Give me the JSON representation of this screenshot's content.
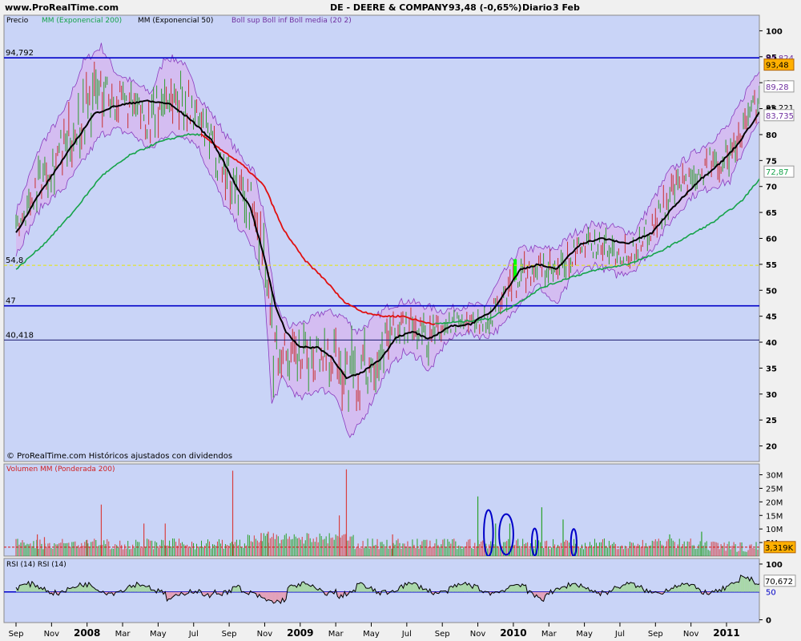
{
  "site": "www.ProRealTime.com",
  "header": {
    "symbol": "DE - DEERE & COMPANY",
    "quote": "93,48 (-0,65%)",
    "period": "Diario",
    "date": "3 Feb"
  },
  "legend": {
    "price": "Precio",
    "ema200": "MM (Exponencial 200)",
    "ema50": "MM (Exponencial 50)",
    "boll": "Boll sup Boll inf Boll media (20 2)"
  },
  "colors": {
    "panel_bg": "#c9d4f7",
    "frame_bg": "#f0f0f0",
    "ema200": "#16a34a",
    "ema50": "#000000",
    "ema_red": "#e01010",
    "boll_fill": "#d6b8f0",
    "boll_line": "#8a3bbf",
    "hline_blue": "#0000c8",
    "hline_yellow": "#e8e800",
    "vol_up": "#2aa12a",
    "vol_down": "#d84040",
    "rsi_line": "#000000",
    "rsi_fill_up": "#a8d7a8",
    "rsi_fill_down": "#e3a0b8",
    "last_badge": "#ffb000",
    "highlight_green": "#00ff00"
  },
  "footer_note": "© ProRealTime.com Históricos ajustados con dividendos",
  "chart_data": [
    {
      "id": "price",
      "type": "line",
      "ylim": [
        17,
        103
      ],
      "y_ticks": [
        100,
        95,
        90,
        85,
        80,
        75,
        70,
        65,
        60,
        55,
        50,
        45,
        40,
        35,
        30,
        25,
        20
      ],
      "x_ticks": [
        "Sep",
        "Nov",
        "2008",
        "Mar",
        "May",
        "Jul",
        "Sep",
        "Nov",
        "2009",
        "Mar",
        "May",
        "Jul",
        "Sep",
        "Nov",
        "2010",
        "Mar",
        "May",
        "Jul",
        "Sep",
        "Nov",
        "2011"
      ],
      "x_ticks_bold": [
        "2008",
        "2009",
        "2010",
        "2011"
      ],
      "series": [
        {
          "name": "MM (Exponencial 50)",
          "values": [
            {
              "x": 0,
              "y": 61
            },
            {
              "x": 0.6,
              "y": 68
            },
            {
              "x": 1.5,
              "y": 77
            },
            {
              "x": 2.2,
              "y": 84
            },
            {
              "x": 2.8,
              "y": 85.5
            },
            {
              "x": 3.6,
              "y": 86.5
            },
            {
              "x": 4.3,
              "y": 86
            },
            {
              "x": 4.9,
              "y": 83
            },
            {
              "x": 5.5,
              "y": 79
            },
            {
              "x": 5.9,
              "y": 74
            },
            {
              "x": 6.2,
              "y": 70
            },
            {
              "x": 6.6,
              "y": 66
            },
            {
              "x": 7.0,
              "y": 56
            },
            {
              "x": 7.3,
              "y": 47
            },
            {
              "x": 7.6,
              "y": 42
            },
            {
              "x": 8.0,
              "y": 39
            },
            {
              "x": 8.5,
              "y": 39
            },
            {
              "x": 8.9,
              "y": 37
            },
            {
              "x": 9.3,
              "y": 33
            },
            {
              "x": 9.7,
              "y": 34
            },
            {
              "x": 10.3,
              "y": 37
            },
            {
              "x": 10.7,
              "y": 41
            },
            {
              "x": 11.2,
              "y": 42
            },
            {
              "x": 11.6,
              "y": 40.5
            },
            {
              "x": 12.2,
              "y": 43
            },
            {
              "x": 12.8,
              "y": 43.5
            },
            {
              "x": 13.4,
              "y": 46
            },
            {
              "x": 13.8,
              "y": 50
            },
            {
              "x": 14.2,
              "y": 54
            },
            {
              "x": 14.7,
              "y": 55
            },
            {
              "x": 15.2,
              "y": 54
            },
            {
              "x": 15.9,
              "y": 59
            },
            {
              "x": 16.5,
              "y": 60
            },
            {
              "x": 17.2,
              "y": 59
            },
            {
              "x": 17.9,
              "y": 61
            },
            {
              "x": 18.5,
              "y": 66
            },
            {
              "x": 19.2,
              "y": 71
            },
            {
              "x": 19.9,
              "y": 75
            },
            {
              "x": 20.3,
              "y": 78
            },
            {
              "x": 20.8,
              "y": 83
            },
            {
              "x": 21.1,
              "y": 86
            }
          ]
        },
        {
          "name": "MM (Exponencial 200)",
          "values": [
            {
              "x": 0,
              "y": 54
            },
            {
              "x": 0.8,
              "y": 59
            },
            {
              "x": 1.6,
              "y": 65
            },
            {
              "x": 2.4,
              "y": 72
            },
            {
              "x": 3.2,
              "y": 76
            },
            {
              "x": 4.0,
              "y": 78.5
            },
            {
              "x": 4.8,
              "y": 80
            },
            {
              "x": 5.2,
              "y": 80
            }
          ]
        },
        {
          "name": "MM (Exponencial 200)",
          "values": [
            {
              "x": 5.2,
              "y": 80
            },
            {
              "x": 5.8,
              "y": 77
            },
            {
              "x": 6.4,
              "y": 74
            },
            {
              "x": 7.0,
              "y": 70
            },
            {
              "x": 7.5,
              "y": 62
            },
            {
              "x": 8.1,
              "y": 56
            },
            {
              "x": 8.7,
              "y": 52
            },
            {
              "x": 9.2,
              "y": 48
            },
            {
              "x": 9.7,
              "y": 46
            },
            {
              "x": 10.3,
              "y": 45
            },
            {
              "x": 10.9,
              "y": 45
            },
            {
              "x": 11.4,
              "y": 44
            },
            {
              "x": 11.8,
              "y": 43.5
            }
          ]
        },
        {
          "name": "MM (Exponencial 200)",
          "values": [
            {
              "x": 11.8,
              "y": 43.5
            },
            {
              "x": 12.6,
              "y": 44
            },
            {
              "x": 13.3,
              "y": 44.5
            },
            {
              "x": 14.0,
              "y": 47
            },
            {
              "x": 14.8,
              "y": 50.5
            },
            {
              "x": 15.6,
              "y": 52.5
            },
            {
              "x": 16.4,
              "y": 54
            },
            {
              "x": 17.2,
              "y": 55
            },
            {
              "x": 18.0,
              "y": 57
            },
            {
              "x": 18.8,
              "y": 60
            },
            {
              "x": 19.6,
              "y": 63
            },
            {
              "x": 20.4,
              "y": 67
            },
            {
              "x": 21.1,
              "y": 72.87
            }
          ]
        },
        {
          "name": "Boll sup",
          "values": [
            {
              "x": 0,
              "y": 65
            },
            {
              "x": 0.7,
              "y": 78
            },
            {
              "x": 1.4,
              "y": 85
            },
            {
              "x": 1.9,
              "y": 94
            },
            {
              "x": 2.4,
              "y": 97
            },
            {
              "x": 2.8,
              "y": 92
            },
            {
              "x": 3.3,
              "y": 90
            },
            {
              "x": 3.8,
              "y": 88
            },
            {
              "x": 4.2,
              "y": 95
            },
            {
              "x": 4.7,
              "y": 94
            },
            {
              "x": 5.1,
              "y": 88
            },
            {
              "x": 5.5,
              "y": 84
            },
            {
              "x": 5.9,
              "y": 80
            },
            {
              "x": 6.3,
              "y": 76
            },
            {
              "x": 6.7,
              "y": 73
            },
            {
              "x": 7.0,
              "y": 64
            },
            {
              "x": 7.3,
              "y": 47
            },
            {
              "x": 7.7,
              "y": 43
            },
            {
              "x": 8.2,
              "y": 44
            },
            {
              "x": 8.7,
              "y": 46
            },
            {
              "x": 9.2,
              "y": 45
            },
            {
              "x": 9.6,
              "y": 42
            },
            {
              "x": 10.0,
              "y": 44
            },
            {
              "x": 10.5,
              "y": 47
            },
            {
              "x": 11.0,
              "y": 48
            },
            {
              "x": 11.5,
              "y": 47
            },
            {
              "x": 12.0,
              "y": 46
            },
            {
              "x": 12.6,
              "y": 47
            },
            {
              "x": 13.2,
              "y": 47
            },
            {
              "x": 13.7,
              "y": 53
            },
            {
              "x": 14.2,
              "y": 58
            },
            {
              "x": 14.7,
              "y": 58
            },
            {
              "x": 15.2,
              "y": 58
            },
            {
              "x": 15.7,
              "y": 61
            },
            {
              "x": 16.3,
              "y": 63
            },
            {
              "x": 16.9,
              "y": 62
            },
            {
              "x": 17.4,
              "y": 61
            },
            {
              "x": 17.9,
              "y": 67
            },
            {
              "x": 18.4,
              "y": 73
            },
            {
              "x": 19.0,
              "y": 76
            },
            {
              "x": 19.6,
              "y": 79
            },
            {
              "x": 20.1,
              "y": 82
            },
            {
              "x": 20.6,
              "y": 89
            },
            {
              "x": 21.1,
              "y": 94.8
            }
          ]
        },
        {
          "name": "Boll inf",
          "values": [
            {
              "x": 0,
              "y": 57
            },
            {
              "x": 0.7,
              "y": 66
            },
            {
              "x": 1.4,
              "y": 70
            },
            {
              "x": 1.9,
              "y": 75
            },
            {
              "x": 2.4,
              "y": 80
            },
            {
              "x": 2.8,
              "y": 81
            },
            {
              "x": 3.3,
              "y": 80
            },
            {
              "x": 3.8,
              "y": 77
            },
            {
              "x": 4.2,
              "y": 80
            },
            {
              "x": 4.7,
              "y": 80
            },
            {
              "x": 5.1,
              "y": 78
            },
            {
              "x": 5.5,
              "y": 72
            },
            {
              "x": 5.9,
              "y": 66
            },
            {
              "x": 6.3,
              "y": 62
            },
            {
              "x": 6.7,
              "y": 58
            },
            {
              "x": 7.0,
              "y": 50
            },
            {
              "x": 7.2,
              "y": 28
            },
            {
              "x": 7.5,
              "y": 33
            },
            {
              "x": 8.0,
              "y": 29
            },
            {
              "x": 8.5,
              "y": 31
            },
            {
              "x": 9.0,
              "y": 30
            },
            {
              "x": 9.4,
              "y": 21
            },
            {
              "x": 9.9,
              "y": 27
            },
            {
              "x": 10.4,
              "y": 34
            },
            {
              "x": 10.9,
              "y": 38
            },
            {
              "x": 11.4,
              "y": 37
            },
            {
              "x": 11.6,
              "y": 34
            },
            {
              "x": 12.1,
              "y": 40
            },
            {
              "x": 12.6,
              "y": 42
            },
            {
              "x": 13.2,
              "y": 41
            },
            {
              "x": 13.7,
              "y": 43
            },
            {
              "x": 14.2,
              "y": 48
            },
            {
              "x": 14.7,
              "y": 51
            },
            {
              "x": 15.2,
              "y": 47
            },
            {
              "x": 15.7,
              "y": 53
            },
            {
              "x": 16.3,
              "y": 55
            },
            {
              "x": 16.9,
              "y": 53
            },
            {
              "x": 17.4,
              "y": 54
            },
            {
              "x": 17.9,
              "y": 58
            },
            {
              "x": 18.4,
              "y": 63
            },
            {
              "x": 19.0,
              "y": 68
            },
            {
              "x": 19.6,
              "y": 70
            },
            {
              "x": 20.1,
              "y": 71
            },
            {
              "x": 20.6,
              "y": 79
            },
            {
              "x": 21.1,
              "y": 83.735
            }
          ]
        }
      ],
      "hlines": [
        {
          "label": "94,792",
          "y": 94.792,
          "color": "#0000c8"
        },
        {
          "label": "54,8",
          "y": 54.8,
          "color": "#e8e800"
        },
        {
          "label": "47",
          "y": 47,
          "color": "#0000c8"
        },
        {
          "label": "40,418",
          "y": 40.418,
          "color": "#1a1a6e"
        }
      ],
      "right_labels": [
        {
          "text": "94,824",
          "y": 94.824,
          "box": "none",
          "color": "#7030a0"
        },
        {
          "text": "93,48",
          "y": 93.48,
          "box": "orange",
          "color": "#000"
        },
        {
          "text": "89,28",
          "y": 89.28,
          "box": "white",
          "color": "#7030a0"
        },
        {
          "text": "85,221",
          "y": 85.221,
          "box": "none",
          "color": "#000"
        },
        {
          "text": "83,735",
          "y": 83.735,
          "box": "white",
          "color": "#7030a0"
        },
        {
          "text": "72,87",
          "y": 72.87,
          "box": "white",
          "color": "#16a34a"
        }
      ]
    },
    {
      "id": "volume",
      "type": "bar",
      "title": "Volumen MM (Ponderada 200)",
      "ylim": [
        0,
        34
      ],
      "y_ticks": [
        {
          "label": "30M",
          "y": 30
        },
        {
          "label": "25M",
          "y": 25
        },
        {
          "label": "20M",
          "y": 20
        },
        {
          "label": "15M",
          "y": 15
        },
        {
          "label": "10M",
          "y": 10
        },
        {
          "label": "5M",
          "y": 5
        }
      ],
      "last_label": "3,319K",
      "ma_level": 3.3,
      "spikes": [
        {
          "x": 9.3,
          "y": 32
        },
        {
          "x": 6.1,
          "y": 31.5
        },
        {
          "x": 2.4,
          "y": 19
        },
        {
          "x": 13.0,
          "y": 22
        },
        {
          "x": 14.8,
          "y": 18
        },
        {
          "x": 6.9,
          "y": 8.5
        },
        {
          "x": 7.1,
          "y": 9
        },
        {
          "x": 4.2,
          "y": 12
        },
        {
          "x": 3.6,
          "y": 12
        },
        {
          "x": 9.1,
          "y": 15
        },
        {
          "x": 10.6,
          "y": 8
        },
        {
          "x": 15.4,
          "y": 13.5
        },
        {
          "x": 13.5,
          "y": 12
        },
        {
          "x": 13.9,
          "y": 12
        },
        {
          "x": 18.4,
          "y": 8
        },
        {
          "x": 19.3,
          "y": 9
        },
        {
          "x": 0.6,
          "y": 8
        },
        {
          "x": 0.8,
          "y": 7
        },
        {
          "x": 2.0,
          "y": 6
        }
      ],
      "ellipses": [
        {
          "x": 13.3,
          "y": 8.5,
          "w": 0.13,
          "h": 8.5
        },
        {
          "x": 13.8,
          "y": 8,
          "w": 0.2,
          "h": 7.5
        },
        {
          "x": 14.6,
          "y": 5.2,
          "w": 0.08,
          "h": 5
        },
        {
          "x": 15.7,
          "y": 5,
          "w": 0.08,
          "h": 5
        }
      ]
    },
    {
      "id": "rsi",
      "type": "area",
      "title": "RSI (14) RSI (14)",
      "ylim": [
        -5,
        110
      ],
      "y_ticks": [
        {
          "label": "100",
          "y": 100
        },
        {
          "label": "0",
          "y": 0
        }
      ],
      "mid": 50,
      "last_label": "70,672",
      "mid_label": "50"
    }
  ]
}
